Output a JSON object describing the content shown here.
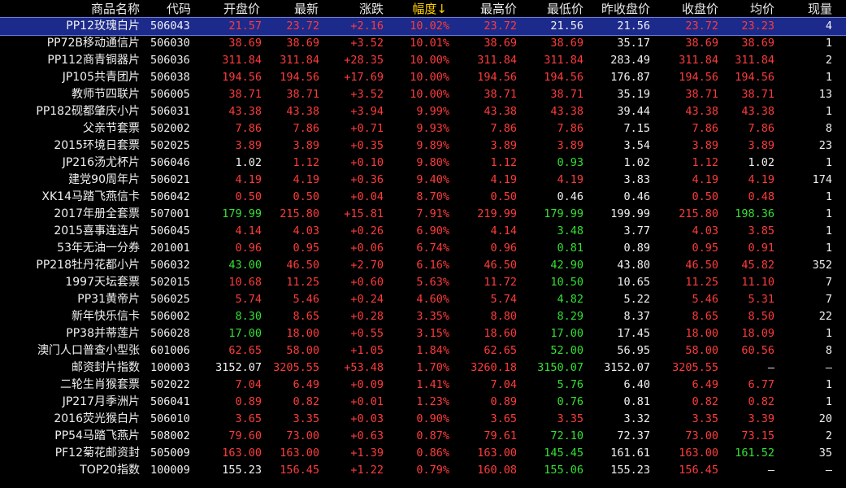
{
  "colors": {
    "up": "#ff3b3b",
    "down": "#33e033",
    "flat": "#f0f0f0",
    "selected_row": "#1c2a8c",
    "sort_header": "#ffd000"
  },
  "columns": [
    {
      "key": "name",
      "label": "商品名称"
    },
    {
      "key": "code",
      "label": "代码"
    },
    {
      "key": "open",
      "label": "开盘价"
    },
    {
      "key": "last",
      "label": "最新"
    },
    {
      "key": "chg",
      "label": "涨跌"
    },
    {
      "key": "pct",
      "label": "幅度↓",
      "sorted": true
    },
    {
      "key": "high",
      "label": "最高价"
    },
    {
      "key": "low",
      "label": "最低价"
    },
    {
      "key": "prev",
      "label": "昨收盘价"
    },
    {
      "key": "close",
      "label": "收盘价"
    },
    {
      "key": "avg",
      "label": "均价"
    },
    {
      "key": "vol",
      "label": "现量"
    }
  ],
  "rows": [
    {
      "name": "PP12玫瑰白片",
      "code": "506043",
      "open": "21.57",
      "last": "23.72",
      "chg": "+2.16",
      "pct": "10.02%",
      "high": "23.72",
      "low": "21.56",
      "prev": "21.56",
      "close": "23.72",
      "avg": "23.23",
      "vol": "4",
      "selected": true,
      "c": {
        "open": "up",
        "last": "up",
        "chg": "up",
        "pct": "up",
        "high": "up",
        "low": "flat",
        "prev": "flat",
        "close": "up",
        "avg": "up"
      }
    },
    {
      "name": "PP72B移动通信片",
      "code": "506030",
      "open": "38.69",
      "last": "38.69",
      "chg": "+3.52",
      "pct": "10.01%",
      "high": "38.69",
      "low": "38.69",
      "prev": "35.17",
      "close": "38.69",
      "avg": "38.69",
      "vol": "1",
      "c": {
        "open": "up",
        "last": "up",
        "chg": "up",
        "pct": "up",
        "high": "up",
        "low": "up",
        "prev": "flat",
        "close": "up",
        "avg": "up"
      }
    },
    {
      "name": "PP112商青铜器片",
      "code": "506036",
      "open": "311.84",
      "last": "311.84",
      "chg": "+28.35",
      "pct": "10.00%",
      "high": "311.84",
      "low": "311.84",
      "prev": "283.49",
      "close": "311.84",
      "avg": "311.84",
      "vol": "2",
      "c": {
        "open": "up",
        "last": "up",
        "chg": "up",
        "pct": "up",
        "high": "up",
        "low": "up",
        "prev": "flat",
        "close": "up",
        "avg": "up"
      }
    },
    {
      "name": "JP105共青团片",
      "code": "506038",
      "open": "194.56",
      "last": "194.56",
      "chg": "+17.69",
      "pct": "10.00%",
      "high": "194.56",
      "low": "194.56",
      "prev": "176.87",
      "close": "194.56",
      "avg": "194.56",
      "vol": "1",
      "c": {
        "open": "up",
        "last": "up",
        "chg": "up",
        "pct": "up",
        "high": "up",
        "low": "up",
        "prev": "flat",
        "close": "up",
        "avg": "up"
      }
    },
    {
      "name": "教师节四联片",
      "code": "506005",
      "open": "38.71",
      "last": "38.71",
      "chg": "+3.52",
      "pct": "10.00%",
      "high": "38.71",
      "low": "38.71",
      "prev": "35.19",
      "close": "38.71",
      "avg": "38.71",
      "vol": "13",
      "c": {
        "open": "up",
        "last": "up",
        "chg": "up",
        "pct": "up",
        "high": "up",
        "low": "up",
        "prev": "flat",
        "close": "up",
        "avg": "up"
      }
    },
    {
      "name": "PP182砚都肇庆小片",
      "code": "506031",
      "open": "43.38",
      "last": "43.38",
      "chg": "+3.94",
      "pct": "9.99%",
      "high": "43.38",
      "low": "43.38",
      "prev": "39.44",
      "close": "43.38",
      "avg": "43.38",
      "vol": "1",
      "c": {
        "open": "up",
        "last": "up",
        "chg": "up",
        "pct": "up",
        "high": "up",
        "low": "up",
        "prev": "flat",
        "close": "up",
        "avg": "up"
      }
    },
    {
      "name": "父亲节套票",
      "code": "502002",
      "open": "7.86",
      "last": "7.86",
      "chg": "+0.71",
      "pct": "9.93%",
      "high": "7.86",
      "low": "7.86",
      "prev": "7.15",
      "close": "7.86",
      "avg": "7.86",
      "vol": "8",
      "c": {
        "open": "up",
        "last": "up",
        "chg": "up",
        "pct": "up",
        "high": "up",
        "low": "up",
        "prev": "flat",
        "close": "up",
        "avg": "up"
      }
    },
    {
      "name": "2015环境日套票",
      "code": "502025",
      "open": "3.89",
      "last": "3.89",
      "chg": "+0.35",
      "pct": "9.89%",
      "high": "3.89",
      "low": "3.89",
      "prev": "3.54",
      "close": "3.89",
      "avg": "3.89",
      "vol": "23",
      "c": {
        "open": "up",
        "last": "up",
        "chg": "up",
        "pct": "up",
        "high": "up",
        "low": "up",
        "prev": "flat",
        "close": "up",
        "avg": "up"
      }
    },
    {
      "name": "JP216汤尤杯片",
      "code": "506046",
      "open": "1.02",
      "last": "1.12",
      "chg": "+0.10",
      "pct": "9.80%",
      "high": "1.12",
      "low": "0.93",
      "prev": "1.02",
      "close": "1.12",
      "avg": "1.02",
      "vol": "1",
      "c": {
        "open": "flat",
        "last": "up",
        "chg": "up",
        "pct": "up",
        "high": "up",
        "low": "down",
        "prev": "flat",
        "close": "up",
        "avg": "flat"
      }
    },
    {
      "name": "建党90周年片",
      "code": "506021",
      "open": "4.19",
      "last": "4.19",
      "chg": "+0.36",
      "pct": "9.40%",
      "high": "4.19",
      "low": "4.19",
      "prev": "3.83",
      "close": "4.19",
      "avg": "4.19",
      "vol": "174",
      "c": {
        "open": "up",
        "last": "up",
        "chg": "up",
        "pct": "up",
        "high": "up",
        "low": "up",
        "prev": "flat",
        "close": "up",
        "avg": "up"
      }
    },
    {
      "name": "XK14马踏飞燕信卡",
      "code": "506042",
      "open": "0.50",
      "last": "0.50",
      "chg": "+0.04",
      "pct": "8.70%",
      "high": "0.50",
      "low": "0.46",
      "prev": "0.46",
      "close": "0.50",
      "avg": "0.48",
      "vol": "1",
      "c": {
        "open": "up",
        "last": "up",
        "chg": "up",
        "pct": "up",
        "high": "up",
        "low": "flat",
        "prev": "flat",
        "close": "up",
        "avg": "up"
      }
    },
    {
      "name": "2017年册全套票",
      "code": "507001",
      "open": "179.99",
      "last": "215.80",
      "chg": "+15.81",
      "pct": "7.91%",
      "high": "219.99",
      "low": "179.99",
      "prev": "199.99",
      "close": "215.80",
      "avg": "198.36",
      "vol": "1",
      "c": {
        "open": "down",
        "last": "up",
        "chg": "up",
        "pct": "up",
        "high": "up",
        "low": "down",
        "prev": "flat",
        "close": "up",
        "avg": "down"
      }
    },
    {
      "name": "2015喜事连连片",
      "code": "506045",
      "open": "4.14",
      "last": "4.03",
      "chg": "+0.26",
      "pct": "6.90%",
      "high": "4.14",
      "low": "3.48",
      "prev": "3.77",
      "close": "4.03",
      "avg": "3.85",
      "vol": "1",
      "c": {
        "open": "up",
        "last": "up",
        "chg": "up",
        "pct": "up",
        "high": "up",
        "low": "down",
        "prev": "flat",
        "close": "up",
        "avg": "up"
      }
    },
    {
      "name": "53年无油一分券",
      "code": "201001",
      "open": "0.96",
      "last": "0.95",
      "chg": "+0.06",
      "pct": "6.74%",
      "high": "0.96",
      "low": "0.81",
      "prev": "0.89",
      "close": "0.95",
      "avg": "0.91",
      "vol": "1",
      "c": {
        "open": "up",
        "last": "up",
        "chg": "up",
        "pct": "up",
        "high": "up",
        "low": "down",
        "prev": "flat",
        "close": "up",
        "avg": "up"
      }
    },
    {
      "name": "PP218牡丹花都小片",
      "code": "506032",
      "open": "43.00",
      "last": "46.50",
      "chg": "+2.70",
      "pct": "6.16%",
      "high": "46.50",
      "low": "42.90",
      "prev": "43.80",
      "close": "46.50",
      "avg": "45.82",
      "vol": "352",
      "c": {
        "open": "down",
        "last": "up",
        "chg": "up",
        "pct": "up",
        "high": "up",
        "low": "down",
        "prev": "flat",
        "close": "up",
        "avg": "up"
      }
    },
    {
      "name": "1997天坛套票",
      "code": "502015",
      "open": "10.68",
      "last": "11.25",
      "chg": "+0.60",
      "pct": "5.63%",
      "high": "11.72",
      "low": "10.50",
      "prev": "10.65",
      "close": "11.25",
      "avg": "11.10",
      "vol": "7",
      "c": {
        "open": "up",
        "last": "up",
        "chg": "up",
        "pct": "up",
        "high": "up",
        "low": "down",
        "prev": "flat",
        "close": "up",
        "avg": "up"
      }
    },
    {
      "name": "PP31黄帝片",
      "code": "506025",
      "open": "5.74",
      "last": "5.46",
      "chg": "+0.24",
      "pct": "4.60%",
      "high": "5.74",
      "low": "4.82",
      "prev": "5.22",
      "close": "5.46",
      "avg": "5.31",
      "vol": "7",
      "c": {
        "open": "up",
        "last": "up",
        "chg": "up",
        "pct": "up",
        "high": "up",
        "low": "down",
        "prev": "flat",
        "close": "up",
        "avg": "up"
      }
    },
    {
      "name": "新年快乐信卡",
      "code": "506002",
      "open": "8.30",
      "last": "8.65",
      "chg": "+0.28",
      "pct": "3.35%",
      "high": "8.80",
      "low": "8.29",
      "prev": "8.37",
      "close": "8.65",
      "avg": "8.50",
      "vol": "22",
      "c": {
        "open": "down",
        "last": "up",
        "chg": "up",
        "pct": "up",
        "high": "up",
        "low": "down",
        "prev": "flat",
        "close": "up",
        "avg": "up"
      }
    },
    {
      "name": "PP38并蒂莲片",
      "code": "506028",
      "open": "17.00",
      "last": "18.00",
      "chg": "+0.55",
      "pct": "3.15%",
      "high": "18.60",
      "low": "17.00",
      "prev": "17.45",
      "close": "18.00",
      "avg": "18.09",
      "vol": "1",
      "c": {
        "open": "down",
        "last": "up",
        "chg": "up",
        "pct": "up",
        "high": "up",
        "low": "down",
        "prev": "flat",
        "close": "up",
        "avg": "up"
      }
    },
    {
      "name": "澳门人口普查小型张",
      "code": "601006",
      "open": "62.65",
      "last": "58.00",
      "chg": "+1.05",
      "pct": "1.84%",
      "high": "62.65",
      "low": "52.00",
      "prev": "56.95",
      "close": "58.00",
      "avg": "60.56",
      "vol": "8",
      "c": {
        "open": "up",
        "last": "up",
        "chg": "up",
        "pct": "up",
        "high": "up",
        "low": "down",
        "prev": "flat",
        "close": "up",
        "avg": "up"
      }
    },
    {
      "name": "邮资封片指数",
      "code": "100003",
      "open": "3152.07",
      "last": "3205.55",
      "chg": "+53.48",
      "pct": "1.70%",
      "high": "3260.18",
      "low": "3150.07",
      "prev": "3152.07",
      "close": "3205.55",
      "avg": "—",
      "vol": "—",
      "c": {
        "open": "flat",
        "last": "up",
        "chg": "up",
        "pct": "up",
        "high": "up",
        "low": "down",
        "prev": "flat",
        "close": "up",
        "avg": "flat"
      }
    },
    {
      "name": "二轮生肖猴套票",
      "code": "502022",
      "open": "7.04",
      "last": "6.49",
      "chg": "+0.09",
      "pct": "1.41%",
      "high": "7.04",
      "low": "5.76",
      "prev": "6.40",
      "close": "6.49",
      "avg": "6.77",
      "vol": "1",
      "c": {
        "open": "up",
        "last": "up",
        "chg": "up",
        "pct": "up",
        "high": "up",
        "low": "down",
        "prev": "flat",
        "close": "up",
        "avg": "up"
      }
    },
    {
      "name": "JP217月季洲片",
      "code": "506041",
      "open": "0.89",
      "last": "0.82",
      "chg": "+0.01",
      "pct": "1.23%",
      "high": "0.89",
      "low": "0.76",
      "prev": "0.81",
      "close": "0.82",
      "avg": "0.82",
      "vol": "1",
      "c": {
        "open": "up",
        "last": "up",
        "chg": "up",
        "pct": "up",
        "high": "up",
        "low": "down",
        "prev": "flat",
        "close": "up",
        "avg": "up"
      }
    },
    {
      "name": "2016荧光猴白片",
      "code": "506010",
      "open": "3.65",
      "last": "3.35",
      "chg": "+0.03",
      "pct": "0.90%",
      "high": "3.65",
      "low": "3.35",
      "prev": "3.32",
      "close": "3.35",
      "avg": "3.39",
      "vol": "20",
      "c": {
        "open": "up",
        "last": "up",
        "chg": "up",
        "pct": "up",
        "high": "up",
        "low": "up",
        "prev": "flat",
        "close": "up",
        "avg": "up"
      }
    },
    {
      "name": "PP54马踏飞燕片",
      "code": "508002",
      "open": "79.60",
      "last": "73.00",
      "chg": "+0.63",
      "pct": "0.87%",
      "high": "79.61",
      "low": "72.10",
      "prev": "72.37",
      "close": "73.00",
      "avg": "73.15",
      "vol": "2",
      "c": {
        "open": "up",
        "last": "up",
        "chg": "up",
        "pct": "up",
        "high": "up",
        "low": "down",
        "prev": "flat",
        "close": "up",
        "avg": "up"
      }
    },
    {
      "name": "PF12菊花邮资封",
      "code": "505009",
      "open": "163.00",
      "last": "163.00",
      "chg": "+1.39",
      "pct": "0.86%",
      "high": "163.00",
      "low": "145.45",
      "prev": "161.61",
      "close": "163.00",
      "avg": "161.52",
      "vol": "35",
      "c": {
        "open": "up",
        "last": "up",
        "chg": "up",
        "pct": "up",
        "high": "up",
        "low": "down",
        "prev": "flat",
        "close": "up",
        "avg": "down"
      }
    },
    {
      "name": "TOP20指数",
      "code": "100009",
      "open": "155.23",
      "last": "156.45",
      "chg": "+1.22",
      "pct": "0.79%",
      "high": "160.08",
      "low": "155.06",
      "prev": "155.23",
      "close": "156.45",
      "avg": "—",
      "vol": "—",
      "c": {
        "open": "flat",
        "last": "up",
        "chg": "up",
        "pct": "up",
        "high": "up",
        "low": "down",
        "prev": "flat",
        "close": "up",
        "avg": "flat"
      }
    }
  ]
}
